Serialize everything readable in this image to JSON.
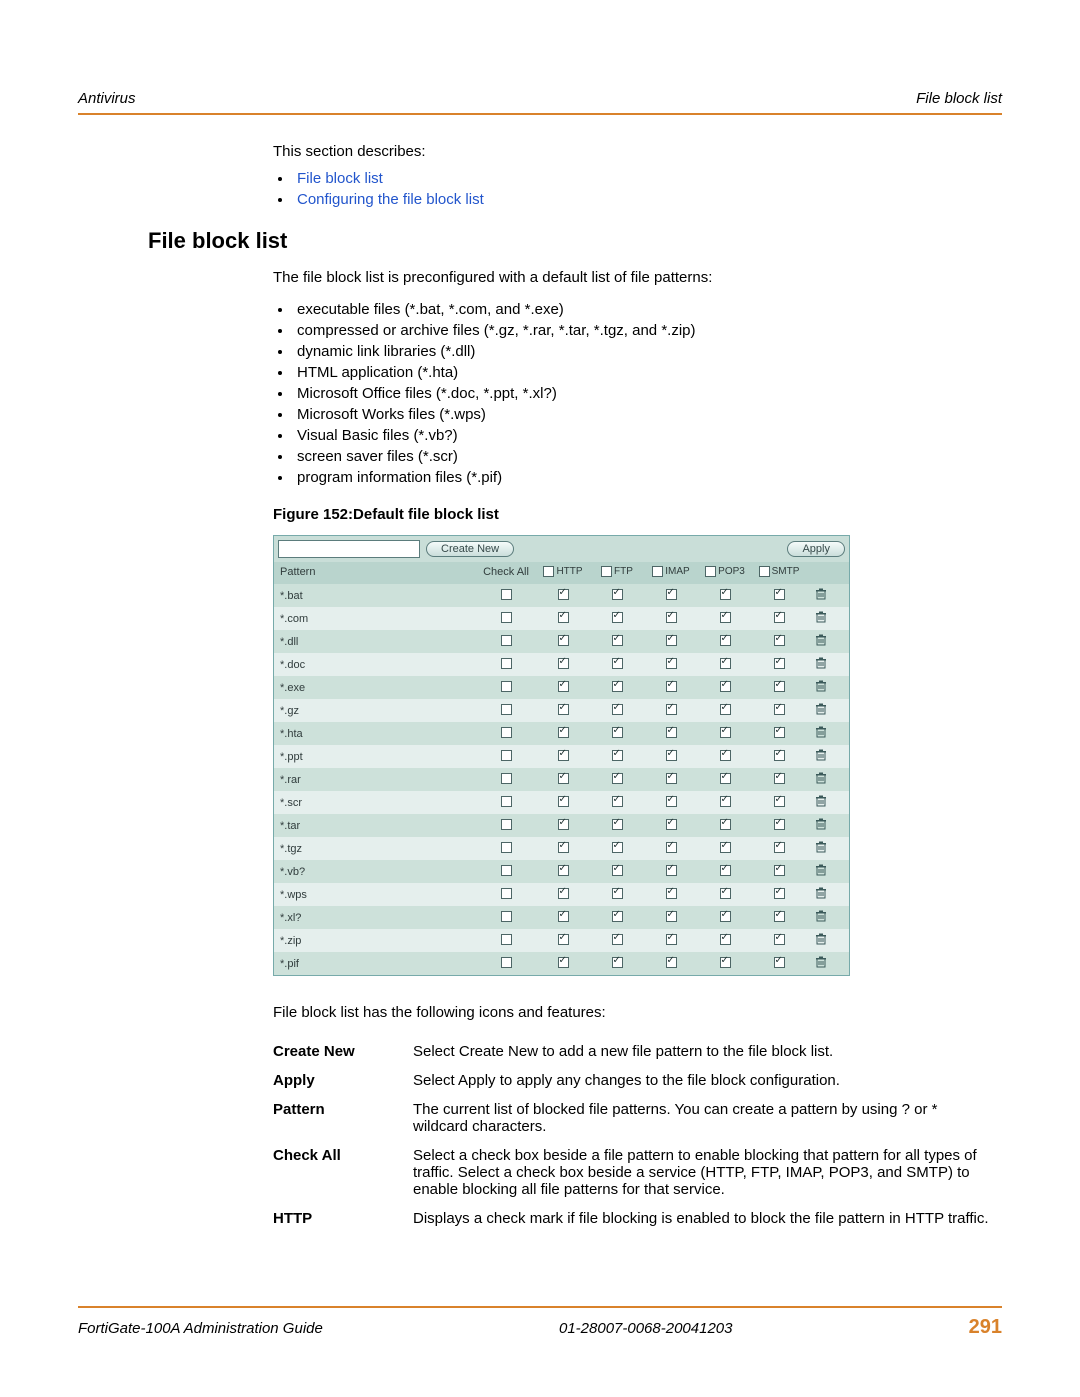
{
  "header": {
    "left": "Antivirus",
    "right": "File block list"
  },
  "intro": "This section describes:",
  "links": [
    {
      "label": "File block list"
    },
    {
      "label": "Configuring the file block list"
    }
  ],
  "section_heading": "File block list",
  "section_intro": "The file block list is preconfigured with a default list of file patterns:",
  "bullets": [
    "executable files (*.bat, *.com, and *.exe)",
    "compressed or archive files (*.gz, *.rar, *.tar, *.tgz, and *.zip)",
    "dynamic link libraries (*.dll)",
    "HTML application (*.hta)",
    "Microsoft Office files (*.doc, *.ppt, *.xl?)",
    "Microsoft Works files (*.wps)",
    "Visual Basic files (*.vb?)",
    "screen saver files (*.scr)",
    "program information files (*.pif)"
  ],
  "figure_caption": "Figure 152:Default file block list",
  "table": {
    "create_label": "Create New",
    "apply_label": "Apply",
    "col_pattern": "Pattern",
    "col_checkall": "Check All",
    "services": [
      "HTTP",
      "FTP",
      "IMAP",
      "POP3",
      "SMTP"
    ],
    "rows": [
      {
        "pattern": "*.bat"
      },
      {
        "pattern": "*.com"
      },
      {
        "pattern": "*.dll"
      },
      {
        "pattern": "*.doc"
      },
      {
        "pattern": "*.exe"
      },
      {
        "pattern": "*.gz"
      },
      {
        "pattern": "*.hta"
      },
      {
        "pattern": "*.ppt"
      },
      {
        "pattern": "*.rar"
      },
      {
        "pattern": "*.scr"
      },
      {
        "pattern": "*.tar"
      },
      {
        "pattern": "*.tgz"
      },
      {
        "pattern": "*.vb?"
      },
      {
        "pattern": "*.wps"
      },
      {
        "pattern": "*.xl?"
      },
      {
        "pattern": "*.zip"
      },
      {
        "pattern": "*.pif"
      }
    ]
  },
  "after_table": "File block list has the following icons and features:",
  "defs": [
    {
      "term": "Create New",
      "desc": "Select Create New to add a new file pattern to the file block list."
    },
    {
      "term": "Apply",
      "desc": "Select Apply to apply any changes to the file block configuration."
    },
    {
      "term": "Pattern",
      "desc": "The current list of blocked file patterns. You can create a pattern by using ? or * wildcard characters."
    },
    {
      "term": "Check All",
      "desc": "Select a check box beside a file pattern to enable blocking that pattern for all types of traffic. Select a check box beside a service (HTTP, FTP, IMAP, POP3, and SMTP) to enable blocking all file patterns for that service."
    },
    {
      "term": "HTTP",
      "desc": "Displays a check mark if file blocking is enabled to block the file pattern in HTTP traffic."
    }
  ],
  "footer": {
    "left": "FortiGate-100A Administration Guide",
    "mid": "01-28007-0068-20041203",
    "page": "291"
  }
}
